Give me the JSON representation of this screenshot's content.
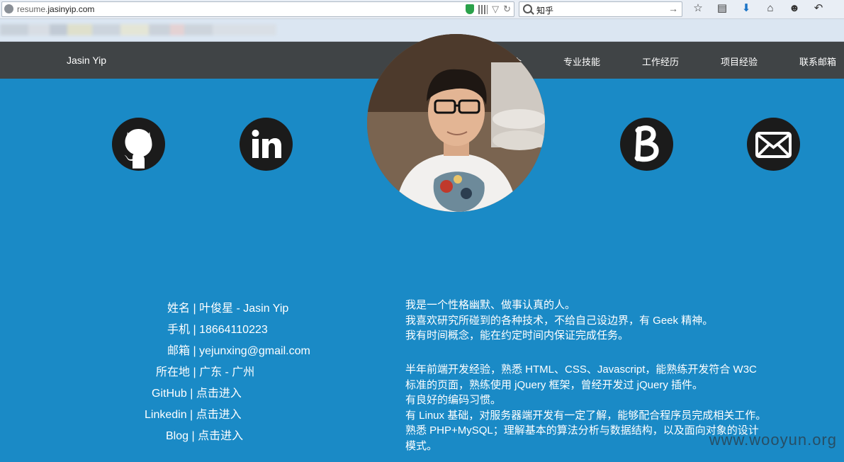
{
  "browser": {
    "url_prefix": "resume.",
    "url_domain": "jasinyip.com",
    "search_value": "知乎",
    "toolbar_icons": [
      "star-icon",
      "bookmarks-icon",
      "download-icon",
      "home-icon",
      "chat-icon",
      "back-icon"
    ]
  },
  "site": {
    "brand": "Jasin Yip",
    "nav": [
      "个人简介",
      "专业技能",
      "工作经历",
      "项目经验",
      "联系邮箱"
    ]
  },
  "social": [
    "github-icon",
    "linkedin-icon",
    "blog-icon",
    "email-icon"
  ],
  "profile": {
    "rows": [
      {
        "label": "姓名",
        "value": "叶俊星 - Jasin Yip"
      },
      {
        "label": "手机",
        "value": "18664110223"
      },
      {
        "label": "邮箱",
        "value": "yejunxing@gmail.com"
      },
      {
        "label": "所在地",
        "value": "广东 - 广州"
      },
      {
        "label": "GitHub",
        "value": "点击进入"
      },
      {
        "label": "Linkedin",
        "value": "点击进入"
      },
      {
        "label": "Blog",
        "value": "点击进入"
      }
    ],
    "separator": " | "
  },
  "about": {
    "para1": [
      "我是一个性格幽默、做事认真的人。",
      "我喜欢研究所碰到的各种技术，不给自己设边界，有 Geek 精神。",
      "我有时间概念，能在约定时间内保证完成任务。"
    ],
    "para2": [
      "半年前端开发经验，熟悉 HTML、CSS、Javascript，能熟练开发符合 W3C",
      "标准的页面，熟练使用 jQuery 框架，曾经开发过 jQuery 插件。",
      "有良好的编码习惯。",
      "有 Linux 基础，对服务器端开发有一定了解，能够配合程序员完成相关工作。",
      "熟悉 PHP+MySQL；理解基本的算法分析与数据结构，以及面向对象的设计",
      "模式。"
    ]
  },
  "watermark": "www.wooyun.org",
  "colors": {
    "background": "#1a8ac6",
    "navbar": "#404446",
    "icon_bg": "#1b1b1b"
  }
}
